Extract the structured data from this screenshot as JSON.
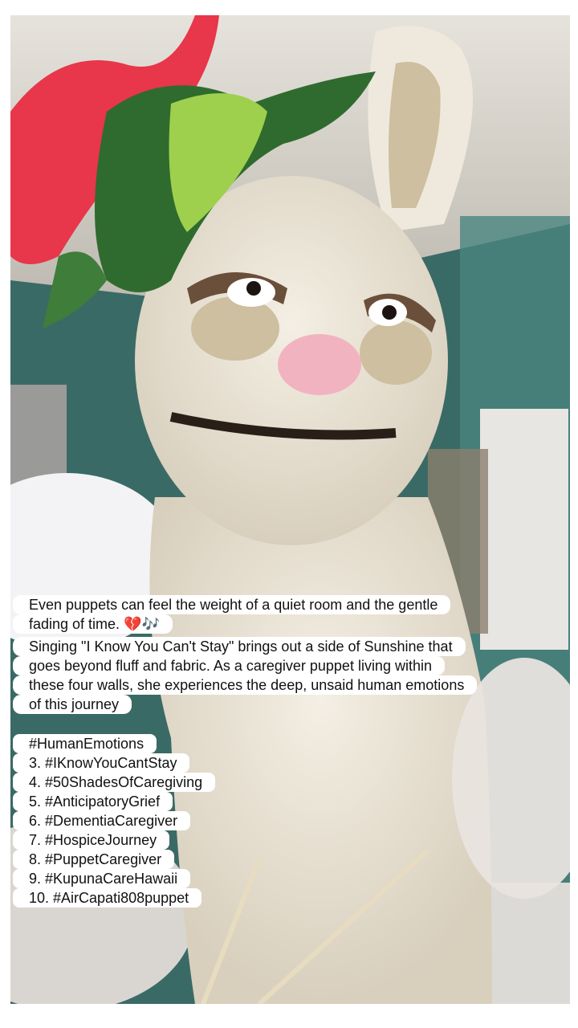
{
  "post": {
    "caption_lines": [
      "Even puppets can feel the weight of a quiet room and the gentle",
      "fading of time. 💔🎶",
      "Singing \"I Know You Can't Stay\" brings out a side of Sunshine that",
      "goes beyond fluff and fabric. As a caregiver puppet living within",
      "these four walls, she experiences the deep, unsaid human emotions",
      "of this journey"
    ],
    "hashtags": [
      "#HumanEmotions",
      "3. #IKnowYouCantStay",
      "4. #50ShadesOfCaregiving",
      "5. #AnticipatoryGrief",
      "6. #DementiaCaregiver",
      "7. #HospiceJourney",
      "8. #PuppetCaregiver",
      "9. #KupunaCareHawaii",
      "10. #AirCapati808puppet"
    ]
  },
  "colors": {
    "wall": "#3e6f6b",
    "ceiling": "#d9d6cf",
    "puppet_fur": "#ede6d8",
    "flower_red": "#e8364a",
    "leaf_green": "#2f6b2e",
    "caption_bg": "#ffffff"
  }
}
